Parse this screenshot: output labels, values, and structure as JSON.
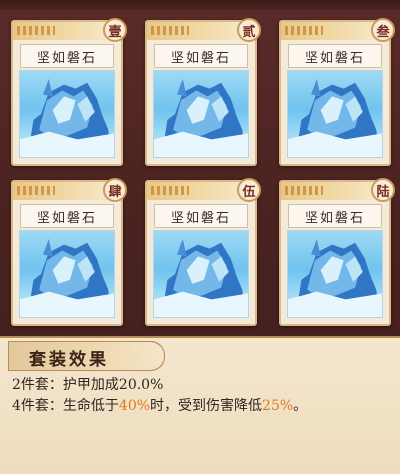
{
  "cards": [
    {
      "name": "坚如磐石",
      "badge": "壹"
    },
    {
      "name": "坚如磐石",
      "badge": "贰"
    },
    {
      "name": "坚如磐石",
      "badge": "叁"
    },
    {
      "name": "坚如磐石",
      "badge": "肆"
    },
    {
      "name": "坚如磐石",
      "badge": "伍"
    },
    {
      "name": "坚如磐石",
      "badge": "陆"
    }
  ],
  "set_effect": {
    "title": "套装效果",
    "line1": {
      "prefix": "2件套：",
      "text": "护甲加成20.0%"
    },
    "line2": {
      "prefix": "4件套：",
      "t1": "生命低于",
      "v1": "40%",
      "t2": "时，受到伤害降低",
      "v2": "25%",
      "t3": "。"
    }
  },
  "colors": {
    "highlight": "#e07a1f",
    "background": "#4a2422",
    "card": "#f4ead7"
  },
  "icons": {
    "card_art": "ice-rock-icon"
  }
}
